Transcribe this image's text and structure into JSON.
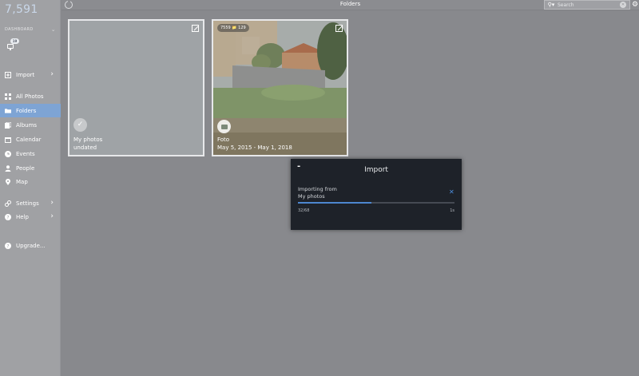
{
  "sidebar": {
    "photo_count": "7,591",
    "dashboard_label": "DASHBOARD",
    "device_badge": "19",
    "import_label": "Import",
    "items": [
      {
        "label": "All Photos",
        "icon": "grid-icon"
      },
      {
        "label": "Folders",
        "icon": "folder-icon"
      },
      {
        "label": "Albums",
        "icon": "albums-icon"
      },
      {
        "label": "Calendar",
        "icon": "calendar-icon"
      },
      {
        "label": "Events",
        "icon": "clock-icon"
      },
      {
        "label": "People",
        "icon": "person-icon"
      },
      {
        "label": "Map",
        "icon": "map-pin-icon"
      }
    ],
    "active_item": "Folders",
    "settings_label": "Settings",
    "help_label": "Help",
    "upgrade_label": "Upgrade..."
  },
  "header": {
    "title": "Folders",
    "search_placeholder": "Search"
  },
  "folders": [
    {
      "name": "My photos",
      "dates": "undated",
      "selected": true
    },
    {
      "name": "Foto",
      "dates": "May 5, 2015 - May 1, 2018",
      "photo_count": "7559",
      "folder_count": "129"
    }
  ],
  "import_dialog": {
    "title": "Import",
    "minimize_label": "-",
    "importing_from_label": "Importing from",
    "source": "My photos",
    "progress_text": "32/68",
    "progress_fraction": 0.47,
    "time_remaining": "1s"
  },
  "colors": {
    "accent": "#7ea4d4",
    "progress": "#4d86cf",
    "dialog_bg": "#1e2229"
  }
}
